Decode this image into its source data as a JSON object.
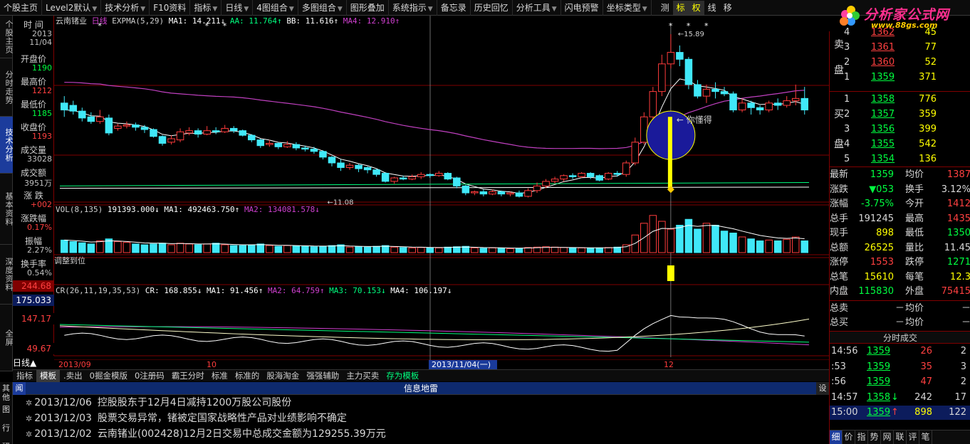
{
  "topmenu": [
    {
      "label": "个股主页",
      "arrow": false
    },
    {
      "label": "Level2默认",
      "arrow": true
    },
    {
      "label": "技术分析",
      "arrow": true
    },
    {
      "label": "F10资料",
      "arrow": false
    },
    {
      "label": "指标",
      "arrow": true
    },
    {
      "label": "日线",
      "arrow": true
    },
    {
      "label": "4图组合",
      "arrow": true
    },
    {
      "label": "多图组合",
      "arrow": true
    },
    {
      "label": "图形叠加",
      "arrow": false
    },
    {
      "label": "系统指示",
      "arrow": true
    },
    {
      "label": "备忘录",
      "arrow": false
    },
    {
      "label": "历史回忆",
      "arrow": false
    },
    {
      "label": "分析工具",
      "arrow": true
    },
    {
      "label": "闪电预警",
      "arrow": false
    },
    {
      "label": "坐标类型",
      "arrow": true
    }
  ],
  "toolbar": [
    "测",
    "标",
    "权",
    "线",
    "移"
  ],
  "logo": {
    "title": "分析家公式网",
    "url": "www.88gs.com"
  },
  "lefttabs": [
    "个股主页",
    "分时走势",
    "技术分析",
    "基本资料",
    "深度资料",
    "全屏",
    "其他"
  ],
  "info": [
    {
      "label": "时  间",
      "values": [
        "2013",
        "11/04"
      ],
      "color": "#c0c0c0"
    },
    {
      "label": "开盘价",
      "values": [
        "1190"
      ],
      "color": "#00ff40"
    },
    {
      "label": "最高价",
      "values": [
        "1212"
      ],
      "color": "#ff4040"
    },
    {
      "label": "最低价",
      "values": [
        "1185"
      ],
      "color": "#00ff40"
    },
    {
      "label": "收盘价",
      "values": [
        "1193"
      ],
      "color": "#ff4040"
    },
    {
      "label": "成交量",
      "values": [
        "33028"
      ],
      "color": "#c0c0c0"
    },
    {
      "label": "成交额",
      "values": [
        "3951万"
      ],
      "color": "#c0c0c0"
    },
    {
      "label": "涨  跌",
      "values": [
        "+002"
      ],
      "color": "#ff4040"
    },
    {
      "label": "涨跌幅",
      "values": [
        "0.17%"
      ],
      "color": "#ff4040"
    },
    {
      "label": "振幅",
      "values": [
        "2.27%"
      ],
      "color": "#c0c0c0"
    },
    {
      "label": "换手率",
      "values": [
        "0.54%"
      ],
      "color": "#c0c0c0"
    }
  ],
  "chart": {
    "stock": "云南锗业",
    "period": "日线",
    "ind_head": "EXPMA(5,29)",
    "ma1": "MA1: 14.211↓",
    "aa": "AA: 11.764↑",
    "bb": "BB: 11.616↑",
    "ma4": "MA4: 12.910↑",
    "high_label": "←15.89",
    "low_label": "←11.08",
    "note": "你懂得",
    "vol_head": "VOL(8,135)",
    "vol_val": "191393.000↓",
    "vol_ma1": "MA1: 492463.750↑",
    "vol_ma2": "MA2: 134081.578↓",
    "adj_label": "调整到位",
    "cr_head": "CR(26,11,19,35,53)",
    "cr_val": "CR: 168.855↓",
    "cr_ma1": "MA1: 91.456↑",
    "cr_ma2": "MA2: 64.759↑",
    "cr_ma3": "MA3: 70.153↓",
    "cr_ma4": "MA4: 106.197↓",
    "yaxis": [
      "244.68",
      "175.033",
      "147.17",
      "49.67"
    ],
    "date_left": "2013/09",
    "date_mid": "2013/11/04(一)",
    "date_10": "10",
    "date_12": "12",
    "period_label": "日线▲"
  },
  "bottomtabs": [
    {
      "label": "指标",
      "cls": ""
    },
    {
      "label": "模板",
      "cls": "sel"
    },
    {
      "label": ".卖出",
      "cls": ""
    },
    {
      "label": "0掘金模版",
      "cls": ""
    },
    {
      "label": "0注册码",
      "cls": ""
    },
    {
      "label": "霸王分时",
      "cls": ""
    },
    {
      "label": "标准",
      "cls": ""
    },
    {
      "label": "标准的",
      "cls": ""
    },
    {
      "label": "股海淘金",
      "cls": ""
    },
    {
      "label": "强强辅助",
      "cls": ""
    },
    {
      "label": "主力买卖",
      "cls": ""
    },
    {
      "label": "存为模板",
      "cls": "green"
    }
  ],
  "news": {
    "title": "信息地雷",
    "left": "闻",
    "right": "设",
    "items": [
      {
        "date": "2013/12/06",
        "text": "控股股东于12月4日减持1200万股公司股份"
      },
      {
        "date": "2013/12/03",
        "text": "股票交易异常，锗被定国家战略性产品对业绩影响不确定"
      },
      {
        "date": "2013/12/02",
        "text": "云南锗业(002428)12月2日交易中总成交金额为129255.39万元"
      }
    ],
    "sidebar": [
      "其",
      "他",
      "闻",
      "图",
      "行",
      "研"
    ]
  },
  "orderbook": {
    "sell_label": [
      "卖",
      "盘"
    ],
    "buy_label": [
      "买",
      "盘"
    ],
    "sell": [
      {
        "n": "4",
        "p": "1362",
        "v": "45"
      },
      {
        "n": "3",
        "p": "1361",
        "v": "77"
      },
      {
        "n": "2",
        "p": "1360",
        "v": "52"
      },
      {
        "n": "1",
        "p": "1359",
        "v": "371"
      }
    ],
    "buy": [
      {
        "n": "1",
        "p": "1358",
        "v": "776"
      },
      {
        "n": "2",
        "p": "1357",
        "v": "359"
      },
      {
        "n": "3",
        "p": "1356",
        "v": "399"
      },
      {
        "n": "4",
        "p": "1355",
        "v": "542"
      },
      {
        "n": "5",
        "p": "1354",
        "v": "136"
      }
    ]
  },
  "stats": [
    {
      "l1": "最新",
      "v1": "1359",
      "c1": "g",
      "l2": "均价",
      "v2": "1387",
      "c2": "r"
    },
    {
      "l1": "涨跌",
      "v1": "▼053",
      "c1": "g",
      "l2": "换手",
      "v2": "3.12%",
      "c2": "w"
    },
    {
      "l1": "涨幅",
      "v1": "-3.75%",
      "c1": "g",
      "l2": "今开",
      "v2": "1412",
      "c2": "r"
    },
    {
      "l1": "总手",
      "v1": "191245",
      "c1": "w",
      "l2": "最高",
      "v2": "1435",
      "c2": "r"
    },
    {
      "l1": "现手",
      "v1": "898",
      "c1": "y",
      "l2": "最低",
      "v2": "1350",
      "c2": "g"
    },
    {
      "l1": "总额",
      "v1": "26525",
      "c1": "y",
      "l2": "量比",
      "v2": "11.45",
      "c2": "w"
    },
    {
      "l1": "涨停",
      "v1": "1553",
      "c1": "r",
      "l2": "跌停",
      "v2": "1271",
      "c2": "g"
    },
    {
      "l1": "总笔",
      "v1": "15610",
      "c1": "y",
      "l2": "每笔",
      "v2": "12.3",
      "c2": "y"
    },
    {
      "l1": "内盘",
      "v1": "115830",
      "c1": "g",
      "l2": "外盘",
      "v2": "75415",
      "c2": "r"
    }
  ],
  "totals": [
    {
      "l": "总卖",
      "v": "－",
      "l2": "均价",
      "v2": "－"
    },
    {
      "l": "总买",
      "v": "－",
      "l2": "均价",
      "v2": "－"
    }
  ],
  "ticks_title": "分时成交",
  "ticks": [
    {
      "t": "14:56",
      "p": "1359",
      "pc": "g",
      "v": "26",
      "vc": "r",
      "n": "2",
      "a": ""
    },
    {
      "t": ":53",
      "p": "1359",
      "pc": "g",
      "v": "35",
      "vc": "r",
      "n": "3",
      "a": ""
    },
    {
      "t": ":56",
      "p": "1359",
      "pc": "g",
      "v": "47",
      "vc": "r",
      "n": "2",
      "a": ""
    },
    {
      "t": "14:57",
      "p": "1358",
      "pc": "g",
      "v": "242",
      "vc": "w",
      "n": "17",
      "a": "↓"
    },
    {
      "t": "15:00",
      "p": "1359",
      "pc": "g",
      "v": "898",
      "vc": "y",
      "n": "122",
      "a": "↑"
    }
  ],
  "rbottom": [
    "细",
    "价",
    "指",
    "势",
    "网",
    "联",
    "评",
    "笔"
  ],
  "candles": [
    [
      12.9,
      12.6,
      13.2,
      12.3
    ],
    [
      12.8,
      12.55,
      13.0,
      12.4
    ],
    [
      12.55,
      12.25,
      12.7,
      12.1
    ],
    [
      12.3,
      12.1,
      12.5,
      12.0
    ],
    [
      12.1,
      12.3,
      12.6,
      12.0
    ],
    [
      12.25,
      11.6,
      12.4,
      11.5
    ],
    [
      11.8,
      11.9,
      12.0,
      11.7
    ],
    [
      11.9,
      11.95,
      12.1,
      11.8
    ],
    [
      11.95,
      11.85,
      12.05,
      11.7
    ],
    [
      11.85,
      11.75,
      11.95,
      11.6
    ],
    [
      11.75,
      11.45,
      11.8,
      11.4
    ],
    [
      11.45,
      11.15,
      11.5,
      11.05
    ],
    [
      11.2,
      11.35,
      11.5,
      11.1
    ],
    [
      11.3,
      11.65,
      11.8,
      11.2
    ],
    [
      11.6,
      11.7,
      11.85,
      11.5
    ],
    [
      11.7,
      11.55,
      11.8,
      11.4
    ],
    [
      11.55,
      11.7,
      11.9,
      11.5
    ],
    [
      11.7,
      11.65,
      11.85,
      11.55
    ],
    [
      11.65,
      11.8,
      11.95,
      11.6
    ],
    [
      11.8,
      11.7,
      11.9,
      11.6
    ],
    [
      11.7,
      11.5,
      11.75,
      11.45
    ],
    [
      11.5,
      11.3,
      11.55,
      11.2
    ],
    [
      11.3,
      11.05,
      11.35,
      10.95
    ],
    [
      11.1,
      11.15,
      11.3,
      11.0
    ],
    [
      11.15,
      11.0,
      11.2,
      10.9
    ],
    [
      11.0,
      11.1,
      11.25,
      10.95
    ],
    [
      11.1,
      10.95,
      11.2,
      10.85
    ],
    [
      10.95,
      10.9,
      11.05,
      10.8
    ],
    [
      10.9,
      10.8,
      11.0,
      10.7
    ],
    [
      10.8,
      10.55,
      10.85,
      10.45
    ],
    [
      10.55,
      10.3,
      10.6,
      10.15
    ],
    [
      10.3,
      10.1,
      10.45,
      9.95
    ],
    [
      10.1,
      10.2,
      10.3,
      10.0
    ],
    [
      10.2,
      10.05,
      10.25,
      9.9
    ],
    [
      10.1,
      10.0,
      10.15,
      9.85
    ],
    [
      10.0,
      9.8,
      10.05,
      9.7
    ],
    [
      9.85,
      9.5,
      9.9,
      9.45
    ],
    [
      9.5,
      9.65,
      9.7,
      9.4
    ],
    [
      9.65,
      9.6,
      9.75,
      9.55
    ],
    [
      9.6,
      9.7,
      9.8,
      9.55
    ],
    [
      9.7,
      9.8,
      9.9,
      9.6
    ],
    [
      9.8,
      9.75,
      9.85,
      9.65
    ],
    [
      9.75,
      9.85,
      9.95,
      9.7
    ],
    [
      9.85,
      9.6,
      9.9,
      9.55
    ],
    [
      9.65,
      9.3,
      9.7,
      9.2
    ],
    [
      9.3,
      9.0,
      9.35,
      8.9
    ],
    [
      9.0,
      9.05,
      9.1,
      8.9
    ],
    [
      9.05,
      8.95,
      9.15,
      8.85
    ],
    [
      8.95,
      9.05,
      9.15,
      8.9
    ],
    [
      9.05,
      8.95,
      9.1,
      8.85
    ],
    [
      8.95,
      9.0,
      9.05,
      8.85
    ],
    [
      9.0,
      8.85,
      9.1,
      8.8
    ],
    [
      8.85,
      9.1,
      9.2,
      8.8
    ],
    [
      9.1,
      9.3,
      9.45,
      9.0
    ],
    [
      9.3,
      9.5,
      9.6,
      9.2
    ],
    [
      9.5,
      9.6,
      9.7,
      9.4
    ],
    [
      9.6,
      9.75,
      9.8,
      9.5
    ],
    [
      9.75,
      9.7,
      9.85,
      9.6
    ],
    [
      9.7,
      9.85,
      9.9,
      9.65
    ],
    [
      9.85,
      9.7,
      9.9,
      9.6
    ],
    [
      9.75,
      9.55,
      9.8,
      9.5
    ],
    [
      9.6,
      9.85,
      9.9,
      9.55
    ],
    [
      9.85,
      9.8,
      9.95,
      9.7
    ],
    [
      9.8,
      10.3,
      10.4,
      9.7
    ],
    [
      10.3,
      11.2,
      11.4,
      10.2
    ],
    [
      11.2,
      12.3,
      12.5,
      11.1
    ],
    [
      12.3,
      13.4,
      13.6,
      12.2
    ],
    [
      13.4,
      14.6,
      15.0,
      13.2
    ],
    [
      14.6,
      15.1,
      15.89,
      14.4
    ],
    [
      15.1,
      14.8,
      15.4,
      14.5
    ],
    [
      14.8,
      13.7,
      14.9,
      13.5
    ],
    [
      13.7,
      13.2,
      13.9,
      13.1
    ],
    [
      13.2,
      13.5,
      13.7,
      12.9
    ],
    [
      13.5,
      13.4,
      13.8,
      13.1
    ],
    [
      13.4,
      13.3,
      13.6,
      13.2
    ],
    [
      13.3,
      12.6,
      13.4,
      12.5
    ],
    [
      12.6,
      12.9,
      13.1,
      12.5
    ],
    [
      12.9,
      12.7,
      13.0,
      12.4
    ],
    [
      12.7,
      12.6,
      12.8,
      12.4
    ],
    [
      12.6,
      12.9,
      13.0,
      12.5
    ],
    [
      12.9,
      12.8,
      13.1,
      12.6
    ],
    [
      12.8,
      13.0,
      13.2,
      12.7
    ],
    [
      13.0,
      13.1,
      13.7,
      12.8
    ],
    [
      13.1,
      12.6,
      13.6,
      12.4
    ]
  ],
  "vol": [
    32,
    28,
    25,
    22,
    30,
    35,
    28,
    26,
    22,
    20,
    22,
    24,
    20,
    24,
    22,
    20,
    22,
    24,
    20,
    18,
    18,
    20,
    22,
    18,
    16,
    18,
    17,
    16,
    15,
    16,
    18,
    20,
    14,
    15,
    14,
    16,
    18,
    14,
    13,
    12,
    13,
    12,
    12,
    14,
    15,
    16,
    12,
    11,
    12,
    11,
    10,
    11,
    13,
    14,
    15,
    14,
    13,
    12,
    12,
    11,
    12,
    13,
    14,
    20,
    45,
    75,
    95,
    80,
    60,
    70,
    85,
    60,
    75,
    70,
    55,
    50,
    40,
    35,
    30,
    32,
    30,
    34,
    40,
    30
  ]
}
